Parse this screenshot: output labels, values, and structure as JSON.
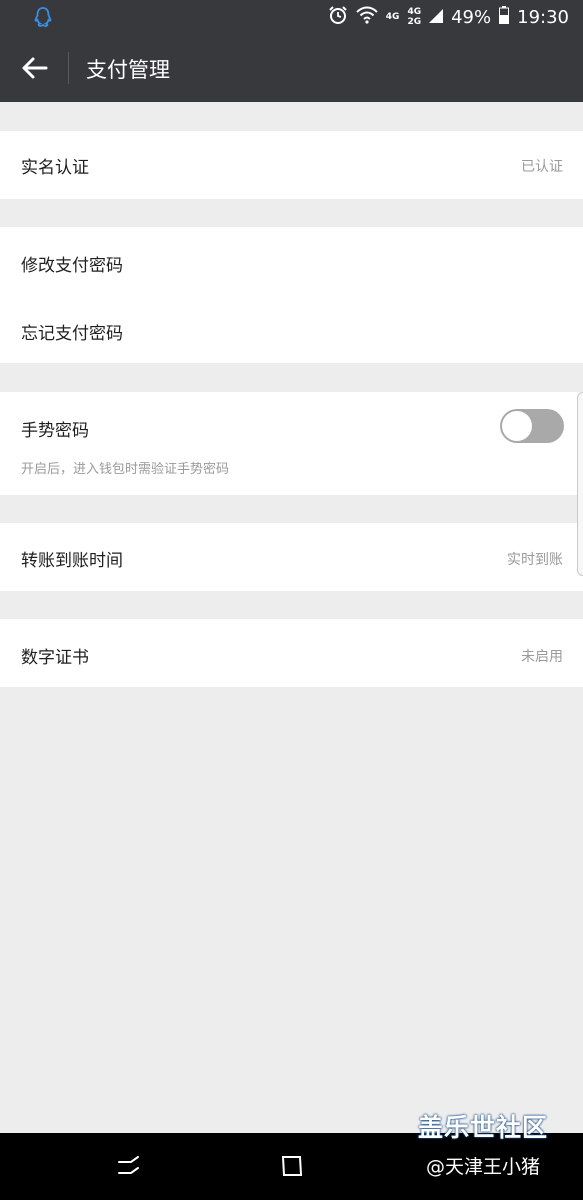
{
  "status_bar": {
    "left_icon": "qq-icon",
    "network_top": "4G",
    "network_dual": "4G",
    "network_dual_2": "2G",
    "battery_percent": "49%",
    "time": "19:30"
  },
  "nav": {
    "title": "支付管理",
    "back_icon": "back-arrow-icon"
  },
  "sections": {
    "realname": {
      "label": "实名认证",
      "value": "已认证"
    },
    "change_pwd": {
      "label": "修改支付密码"
    },
    "forgot_pwd": {
      "label": "忘记支付密码"
    },
    "gesture": {
      "label": "手势密码",
      "hint": "开启后，进入钱包时需验证手势密码",
      "toggle_on": false
    },
    "transfer_time": {
      "label": "转账到账时间",
      "value": "实时到账"
    },
    "digital_cert": {
      "label": "数字证书",
      "value": "未启用"
    }
  },
  "watermark": {
    "brand": "盖乐世社区",
    "user": "@天津王小猪"
  },
  "colors": {
    "header_bg": "#38393c",
    "page_bg": "#ededed",
    "toggle_off": "#a9a9a9"
  }
}
